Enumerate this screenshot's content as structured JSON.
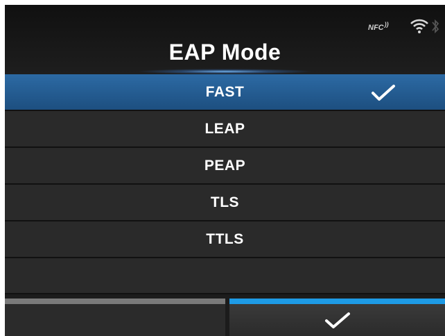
{
  "header": {
    "title": "EAP Mode",
    "nfc_label": "NFC",
    "icons": [
      "nfc-icon",
      "wifi-icon",
      "bluetooth-icon"
    ]
  },
  "options": [
    {
      "label": "FAST",
      "selected": true
    },
    {
      "label": "LEAP",
      "selected": false
    },
    {
      "label": "PEAP",
      "selected": false
    },
    {
      "label": "TLS",
      "selected": false
    },
    {
      "label": "TTLS",
      "selected": false
    }
  ],
  "softkeys": {
    "left": {
      "icon": "none"
    },
    "right": {
      "icon": "checkmark-icon"
    }
  },
  "colors": {
    "selected_row": "#2c6aa4",
    "confirm_accent": "#1e9be6",
    "left_accent": "#7a7a7a"
  }
}
